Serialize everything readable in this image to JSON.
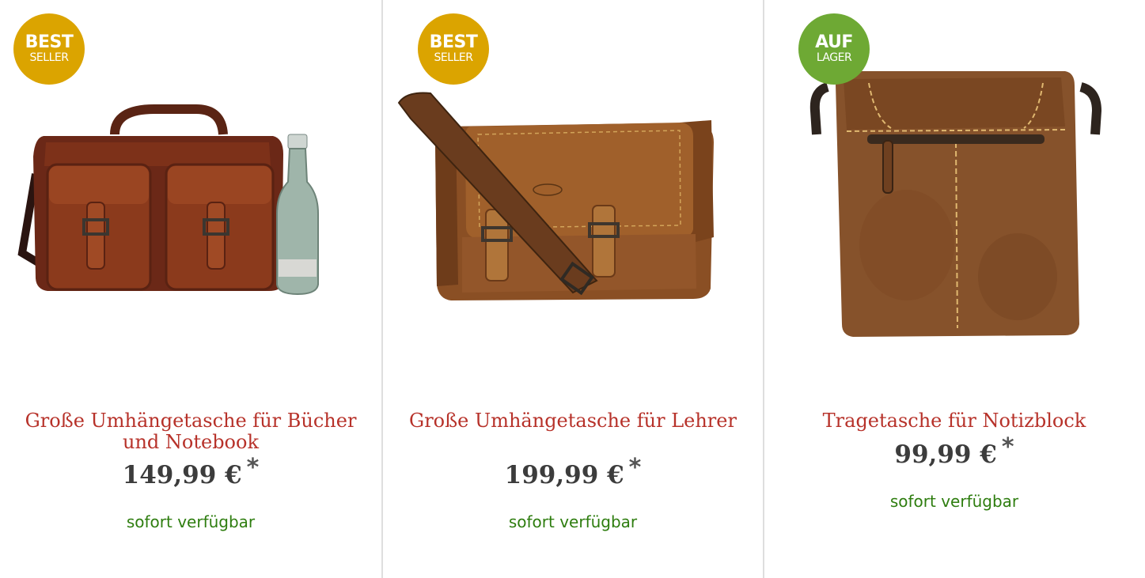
{
  "products": [
    {
      "badge_line1": "BEST",
      "badge_line2": "SELLER",
      "image_icon": "leather-briefcase-with-bottle",
      "title": "Große Umhängetasche für Bücher und Notebook",
      "price": "149,99 €",
      "price_marker": "*",
      "availability": "sofort verfügbar"
    },
    {
      "badge_line1": "BEST",
      "badge_line2": "SELLER",
      "image_icon": "leather-messenger-bag",
      "title": "Große Umhängetasche für Lehrer",
      "price": "199,99 €",
      "price_marker": "*",
      "availability": "sofort verfügbar"
    },
    {
      "badge_line1": "AUF",
      "badge_line2": "LAGER",
      "image_icon": "leather-notepad-bag",
      "title": "Tragetasche für Notizblock",
      "price": "99,99 €",
      "price_marker": "*",
      "availability": "sofort verfügbar"
    }
  ],
  "colors": {
    "title": "#b7322a",
    "availability": "#2e7d0f",
    "badge_best_seller": "#dba400",
    "badge_auf_lager": "#6ea934"
  }
}
